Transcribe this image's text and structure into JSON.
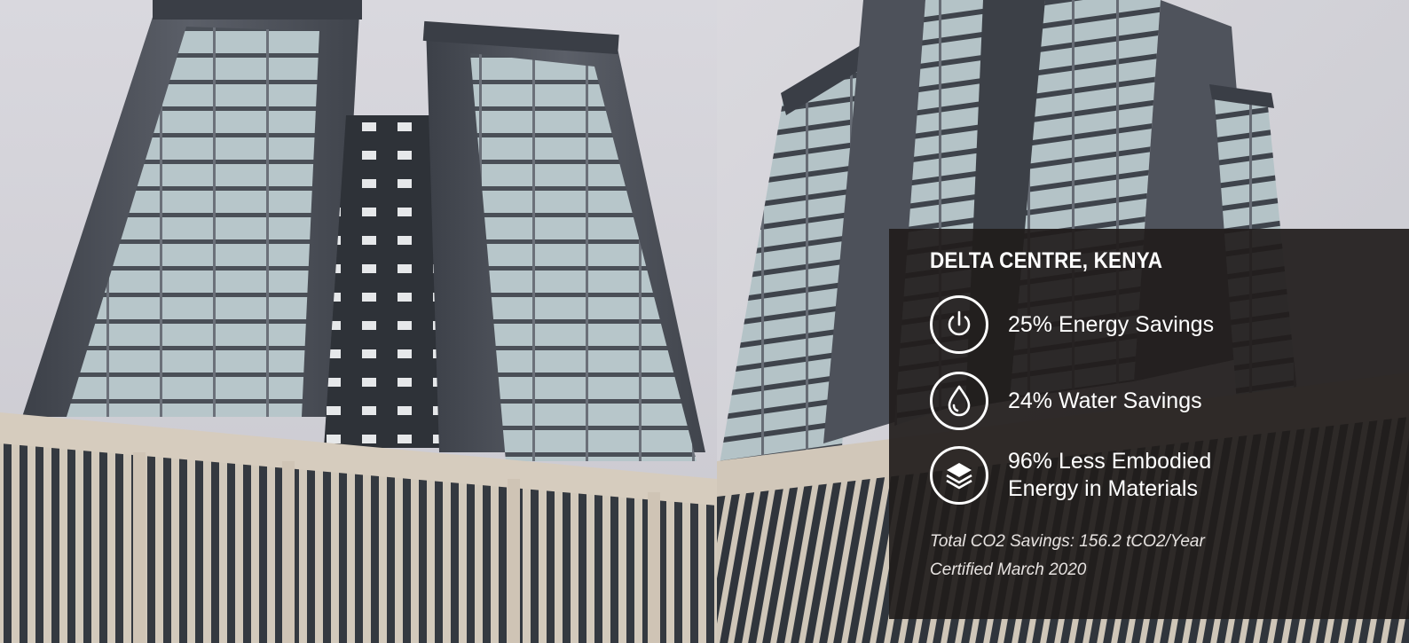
{
  "panel": {
    "title": "DELTA CENTRE, KENYA",
    "stats": [
      {
        "icon": "power-icon",
        "label": "25% Energy Savings"
      },
      {
        "icon": "water-drop-icon",
        "label": "24% Water Savings"
      },
      {
        "icon": "layers-icon",
        "label": "96% Less Embodied\nEnergy in Materials"
      }
    ],
    "footnote": {
      "co2": "Total CO2 Savings: 156.2 tCO2/Year",
      "certified": "Certified March 2020"
    }
  },
  "colors": {
    "panel_background": "#211c1b",
    "panel_text": "#ffffff",
    "sky": "#d3d3da",
    "cladding": "#4b4f58",
    "glass": "#aebfc4",
    "podium": "#d5cbbd",
    "louvers": "#2f343b"
  }
}
